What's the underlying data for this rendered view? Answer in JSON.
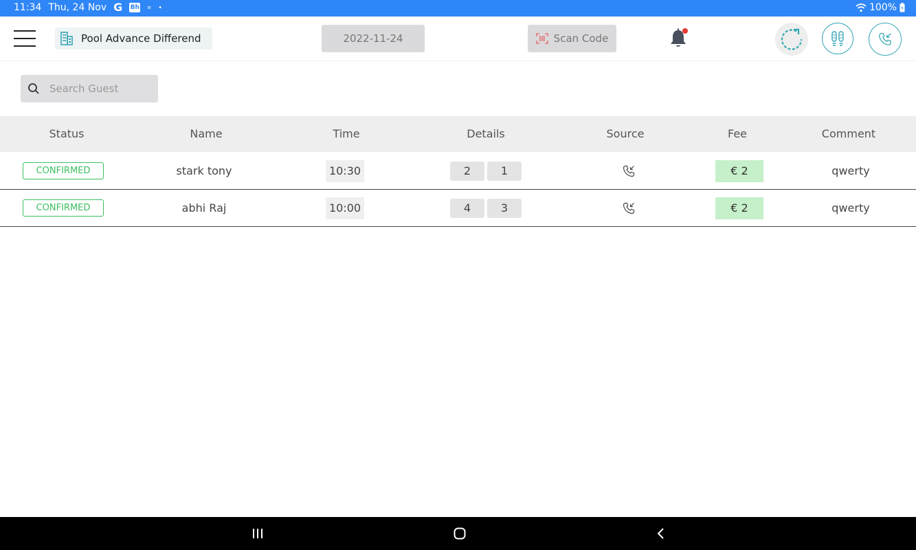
{
  "status_bar": {
    "time": "11:34",
    "date": "Thu, 24 Nov",
    "g_icon": "G",
    "app_icon_text": "Bh",
    "mini_icon": "≡",
    "dot": "•",
    "battery": "100%"
  },
  "header": {
    "venue_name": "Pool Advance Differend",
    "date": "2022-11-24",
    "scan_label": "Scan Code"
  },
  "search": {
    "placeholder": "Search Guest"
  },
  "table": {
    "columns": [
      "Status",
      "Name",
      "Time",
      "Details",
      "Source",
      "Fee",
      "Comment"
    ],
    "rows": [
      {
        "status": "CONFIRMED",
        "name": "stark tony",
        "time": "10:30",
        "details": [
          "2",
          "1"
        ],
        "source": "phone-incoming-icon",
        "fee": "€ 2",
        "comment": "qwerty"
      },
      {
        "status": "CONFIRMED",
        "name": "abhi Raj",
        "time": "10:00",
        "details": [
          "4",
          "3"
        ],
        "source": "phone-incoming-icon",
        "fee": "€ 2",
        "comment": "qwerty"
      }
    ]
  },
  "colors": {
    "status_bar": "#2f86f6",
    "accent_teal": "#37a7b5",
    "confirmed_green": "#3cbf60",
    "fee_bg": "#c5f0c9",
    "notification_dot": "#e53935"
  }
}
